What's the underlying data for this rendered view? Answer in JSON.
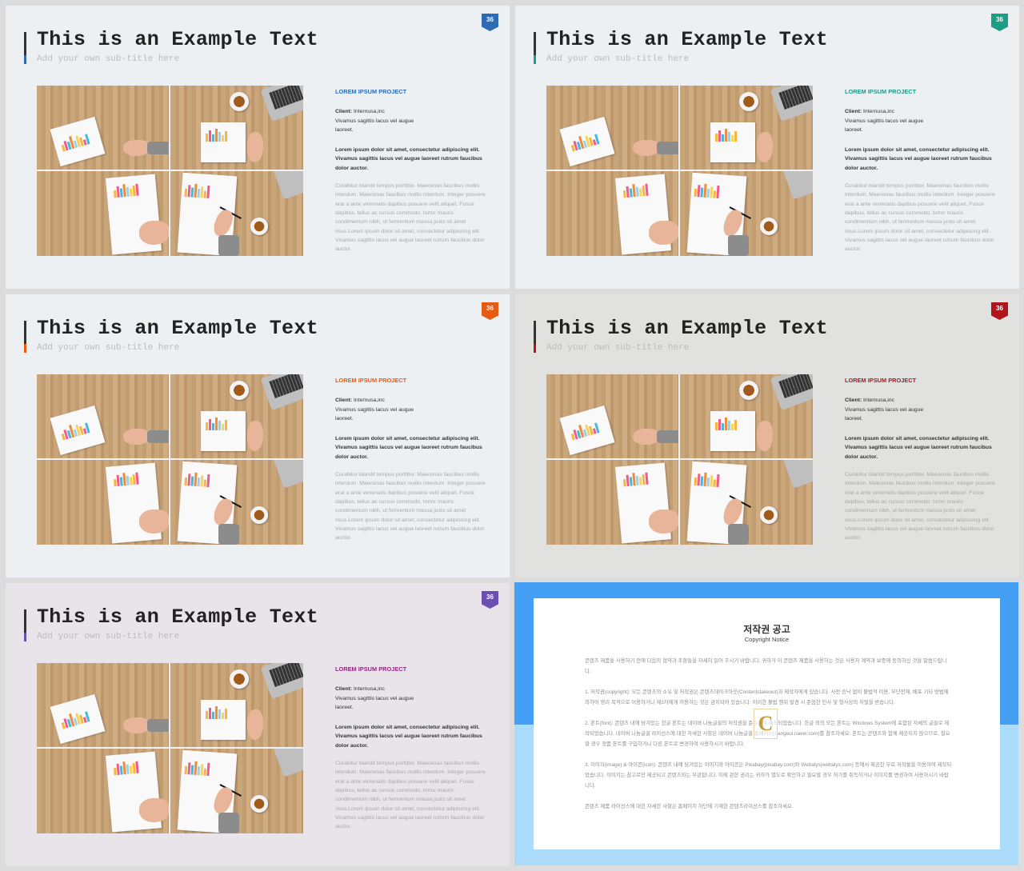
{
  "slides": [
    {
      "bg": "#ecf0f3",
      "accent": "#2d6cb5",
      "title": "This is an Example Text",
      "subtitle": "Add your own sub-title here",
      "page": "36",
      "project": "LOREM IPSUM PROJECT",
      "client_label": "Client:",
      "client_value": " Internusa,inc",
      "client_line2": "Vivamus sagittis lacus vel augue",
      "client_line3": "laoreet.",
      "bold_text": "Lorem ipsum dolor sit amet, consectetur adipiscing elit. Vivamus sagittis lacus vel augue laoreet rutrum faucibus dolor auctor.",
      "light_text": "Curabitur blandit tempus porttitor. Maecenas faucibus mollis interdum. Maecenas faucibus mollis interdum. Integer posuere erat a ante venenatis dapibus posuere velit aliquet. Fusce dapibus, tellus ac cursus commodo, tortor mauris condimentum nibh, ut fermentum massa justo sit amet risus.Lorem ipsum dolor sit amet, consectetur adipiscing elit. Vivamus sagittis lacus vel augue laoreet rutrum faucibus dolor auctor."
    },
    {
      "bg": "#ecf0f3",
      "accent": "#1d9c86",
      "title": "This is an Example Text",
      "subtitle": "Add your own sub-title here",
      "page": "36",
      "project": "LOREM IPSUM PROJECT",
      "client_label": "Client:",
      "client_value": " Internusa,inc",
      "client_line2": "Vivamus sagittis lacus vel augue",
      "client_line3": "laoreet.",
      "bold_text": "Lorem ipsum dolor sit amet, consectetur adipiscing elit. Vivamus sagittis lacus vel augue laoreet rutrum faucibus dolor auctor.",
      "light_text": "Curabitur blandit tempus porttitor. Maecenas faucibus mollis interdum. Maecenas faucibus mollis interdum. Integer posuere erat a ante venenatis dapibus posuere velit aliquet. Fusce dapibus, tellus ac cursus commodo, tortor mauris condimentum nibh, ut fermentum massa justo sit amet risus.Lorem ipsum dolor sit amet, consectetur adipiscing elit. Vivamus sagittis lacus vel augue laoreet rutrum faucibus dolor auctor."
    },
    {
      "bg": "#ecf0f3",
      "accent": "#e55b13",
      "title": "This is an Example Text",
      "subtitle": "Add your own sub-title here",
      "page": "36",
      "project": "LOREM IPSUM PROJECT",
      "client_label": "Client:",
      "client_value": " Internusa,inc",
      "client_line2": "Vivamus sagittis lacus vel augue",
      "client_line3": "laoreet.",
      "bold_text": "Lorem ipsum dolor sit amet, consectetur adipiscing elit. Vivamus sagittis lacus vel augue laoreet rutrum faucibus dolor auctor.",
      "light_text": "Curabitur blandit tempus porttitor. Maecenas faucibus mollis interdum. Maecenas faucibus mollis interdum. Integer posuere erat a ante venenatis dapibus posuere velit aliquet. Fusce dapibus, tellus ac cursus commodo, tortor mauris condimentum nibh, ut fermentum massa justo sit amet risus.Lorem ipsum dolor sit amet, consectetur adipiscing elit. Vivamus sagittis lacus vel augue laoreet rutrum faucibus dolor auctor."
    },
    {
      "bg": "#e1e1df",
      "accent": "#b1141b",
      "title": "This is an Example Text",
      "subtitle": "Add your own sub-title here",
      "page": "36",
      "project": "LOREM IPSUM PROJECT",
      "client_label": "Client:",
      "client_value": " Internusa,inc",
      "client_line2": "Vivamus sagittis lacus vel augue",
      "client_line3": "laoreet.",
      "bold_text": "Lorem ipsum dolor sit amet, consectetur adipiscing elit. Vivamus sagittis lacus vel augue laoreet rutrum faucibus dolor auctor.",
      "light_text": "Curabitur blandit tempus porttitor. Maecenas faucibus mollis interdum. Maecenas faucibus mollis interdum. Integer posuere erat a ante venenatis dapibus posuere velit aliquet. Fusce dapibus, tellus ac cursus commodo, tortor mauris condimentum nibh, ut fermentum massa justo sit amet risus.Lorem ipsum dolor sit amet, consectetur adipiscing elit. Vivamus sagittis lacus vel augue laoreet rutrum faucibus dolor auctor."
    },
    {
      "bg": "#e8e4ea",
      "accent": "#6b4fb3",
      "project_color": "#8e2a7e",
      "title": "This is an Example Text",
      "subtitle": "Add your own sub-title here",
      "page": "36",
      "project": "LOREM IPSUM PROJECT",
      "client_label": "Client:",
      "client_value": " Internusa,inc",
      "client_line2": "Vivamus sagittis lacus vel augue",
      "client_line3": "laoreet.",
      "bold_text": "Lorem ipsum dolor sit amet, consectetur adipiscing elit. Vivamus sagittis lacus vel augue laoreet rutrum faucibus dolor auctor.",
      "light_text": "Curabitur blandit tempus porttitor. Maecenas faucibus mollis interdum. Maecenas faucibus mollis interdum. Integer posuere erat a ante venenatis dapibus posuere velit aliquet. Fusce dapibus, tellus ac cursus commodo, tortor mauris condimentum nibh, ut fermentum massa justo sit amet risus.Lorem ipsum dolor sit amet, consectetur adipiscing elit. Vivamus sagittis lacus vel augue laoreet rutrum faucibus dolor auctor."
    }
  ],
  "notice": {
    "title": "저작권 공고",
    "subtitle": "Copyright Notice",
    "logo_letter": "C",
    "paragraphs": [
      "콘텐츠 제품을 사용하기 전에 다음의 협약과 조항들을 자세히 읽어 주시기 바랍니다. 귀하가 이 콘텐츠 제품을 사용하는 것은 사용자 계약과 보증에 동의하신 것을 말씀드립니다.",
      "1. 저작권(copyright): 모든 콘텐츠의 소유 및 저작권은 콘텐츠데이크아웃(Contentstakeout)과 제작자에게 있습니다. 사전 승낙 없이 불법적 이용, 무단전재, 배포 기타 방법에 의하여 영리 목적으로 이용하거나 제3자에게 이용하는 것은 금지되어 있습니다. 이러한 불법 행위 발견 시 준엄한 민사 및 형사상의 처벌을 받습니다.",
      "2. 폰트(font): 콘텐츠 내에 담겨있는 한글 폰트는 네이버 나눔글꼴의 저작권을 준수하여 제작되었습니다. 한글 외의 모든 폰트는 Windows System에 포함된 자체의 글꼴로 제작되었습니다. 네이버 나눔글꼴 라이선스에 대한 자세한 사항은 네이버 나눔글꼴 홈페이지(hangeul.naver.com)를 참조하세요. 폰트는 콘텐츠와 함께 제공되지 않으므로, 필요할 경우 정품 폰트를 구입하거나 다른 폰트로 변경하여 사용하시기 바랍니다.",
      "3. 이미지(image) & 아이콘(icon): 콘텐츠 내에 담겨있는 이미지와 아이콘은 Pixabay(pixabay.com)와 Webalys(webalys.com) 등에서 제공한 무료 저작물을 이용하여 제작되었습니다. 이미지는 참고로만 제공되고 콘텐츠와는 무관합니다. 이에 관한 권리는 귀하가 별도로 확인하고 필요할 경우 허가를 취득하거나 이미지를 변경하여 사용하시기 바랍니다.",
      "콘텐츠 제품 라이선스에 대한 자세한 사항은 홈페이지 하단에 기재한 콘텐츠라이선스를 참조하세요."
    ]
  }
}
